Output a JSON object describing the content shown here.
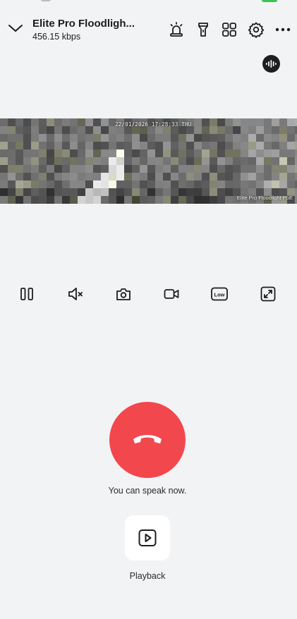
{
  "header": {
    "device_name": "Elite Pro Floodligh...",
    "bitrate": "456.15 kbps"
  },
  "video": {
    "timestamp": "22/01/2026 17:28:33 THU",
    "camera_label": "Elite Pro Floodlight PoE"
  },
  "controls": {
    "quality_label": "Low"
  },
  "call": {
    "status_text": "You can speak now."
  },
  "playback": {
    "label": "Playback"
  },
  "colors": {
    "background": "#f2f3f5",
    "hangup": "#f2484d",
    "icon": "#1c1c1e",
    "status_battery": "#3bc15a"
  },
  "icons": {
    "back": "chevron-down-icon",
    "alarm": "siren-icon",
    "flashlight": "flashlight-icon",
    "grid": "grid-icon",
    "settings": "gear-icon",
    "more": "more-icon",
    "audio": "audio-wave-icon",
    "pause": "pause-icon",
    "mute": "speaker-muted-icon",
    "snapshot": "camera-icon",
    "record": "video-record-icon",
    "quality": "quality-low-icon",
    "fullscreen": "fullscreen-icon",
    "hangup": "phone-hangup-icon",
    "playback": "playback-icon"
  }
}
